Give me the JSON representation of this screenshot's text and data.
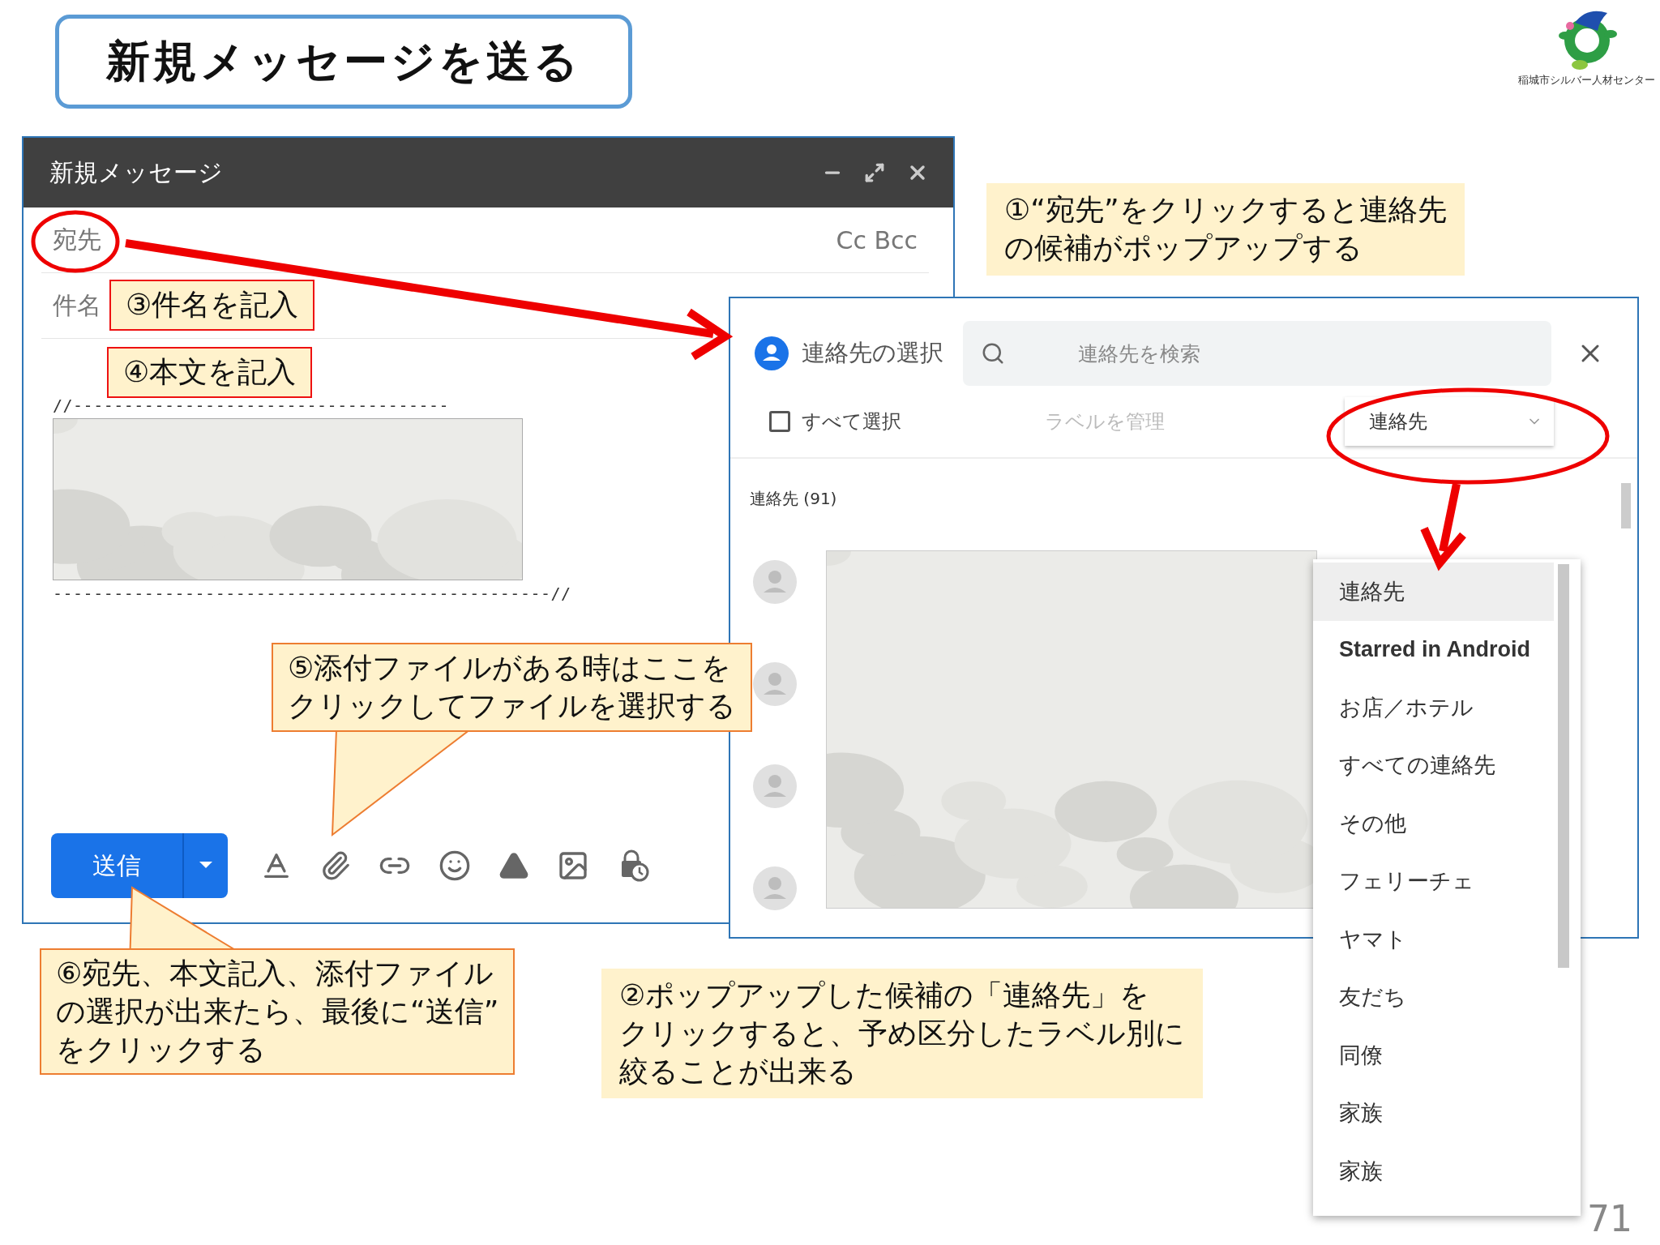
{
  "slide_title": "新規メッセージを送る",
  "logo": {
    "caption": "稲城市シルバー人材センター"
  },
  "compose": {
    "title": "新規メッセージ",
    "to_label": "宛先",
    "cc_bcc": "Cc Bcc",
    "subject_label": "件名",
    "body_top_line": "//-------------------------------------",
    "body_bottom_line": "-------------------------------------------------//",
    "send_button": "送信"
  },
  "contact_picker": {
    "title": "連絡先の選択",
    "search": {
      "placeholder": "連絡先を検索"
    },
    "select_all": {
      "label": "すべて選択",
      "checked": false
    },
    "manage_labels": {
      "label": "ラベルを管理",
      "disabled": true
    },
    "label_dropdown": {
      "value": "連絡先"
    },
    "section_heading": "連絡先 (91)"
  },
  "label_menu": [
    {
      "label": "連絡先",
      "selected": true,
      "bold": false
    },
    {
      "label": "Starred in Android",
      "selected": false,
      "bold": true
    },
    {
      "label": "お店／ホテル",
      "selected": false,
      "bold": false
    },
    {
      "label": "すべての連絡先",
      "selected": false,
      "bold": false
    },
    {
      "label": "その他",
      "selected": false,
      "bold": false
    },
    {
      "label": "フェリーチェ",
      "selected": false,
      "bold": false
    },
    {
      "label": "ヤマト",
      "selected": false,
      "bold": false
    },
    {
      "label": "友だち",
      "selected": false,
      "bold": false
    },
    {
      "label": "同僚",
      "selected": false,
      "bold": false
    },
    {
      "label": "家族",
      "selected": false,
      "bold": false
    },
    {
      "label": "家族",
      "selected": false,
      "bold": false
    }
  ],
  "callouts": [
    {
      "kind": "plain",
      "lines": [
        "①“宛先”をクリックすると連絡先",
        "の候補がポップアップする"
      ]
    },
    {
      "kind": "boxed",
      "lines": [
        "③件名を記入"
      ]
    },
    {
      "kind": "boxed",
      "lines": [
        "④本文を記入"
      ]
    },
    {
      "kind": "speech",
      "lines": [
        "⑤添付ファイルがある時はここを",
        "クリックしてファイルを選択する"
      ]
    },
    {
      "kind": "speech",
      "lines": [
        "⑥宛先、本文記入、添付ファイル",
        "の選択が出来たら、最後に“送信”",
        "をクリックする"
      ]
    },
    {
      "kind": "plain",
      "lines": [
        "②ポップアップした候補の「連絡先」を",
        "クリックすると、予め区分したラベル別に",
        "絞ることが出来る"
      ]
    }
  ],
  "page_number": "71"
}
